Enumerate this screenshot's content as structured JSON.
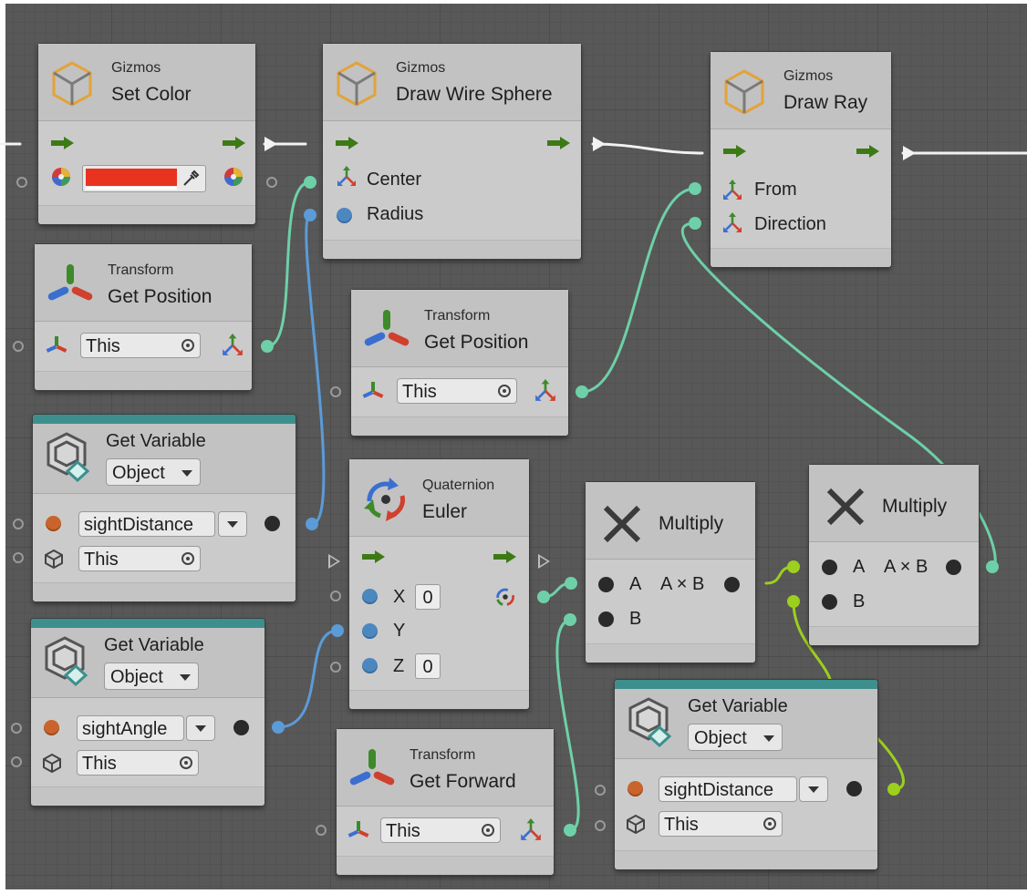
{
  "nodes": {
    "set_color": {
      "category": "Gizmos",
      "title": "Set Color",
      "color_value": "#e8331e"
    },
    "draw_wire_sphere": {
      "category": "Gizmos",
      "title": "Draw Wire Sphere",
      "center_label": "Center",
      "radius_label": "Radius"
    },
    "draw_ray": {
      "category": "Gizmos",
      "title": "Draw Ray",
      "from_label": "From",
      "direction_label": "Direction"
    },
    "get_position_1": {
      "category": "Transform",
      "title": "Get Position",
      "target": "This"
    },
    "get_position_2": {
      "category": "Transform",
      "title": "Get Position",
      "target": "This"
    },
    "get_var_1": {
      "title": "Get Variable",
      "kind": "Object",
      "name": "sightDistance",
      "target": "This"
    },
    "get_var_2": {
      "title": "Get Variable",
      "kind": "Object",
      "name": "sightAngle",
      "target": "This"
    },
    "get_var_3": {
      "title": "Get Variable",
      "kind": "Object",
      "name": "sightDistance",
      "target": "This"
    },
    "euler": {
      "category": "Quaternion",
      "title": "Euler",
      "x_label": "X",
      "x_value": "0",
      "y_label": "Y",
      "z_label": "Z",
      "z_value": "0"
    },
    "multiply_1": {
      "title": "Multiply",
      "a_label": "A",
      "b_label": "B",
      "out_label": "A × B"
    },
    "multiply_2": {
      "title": "Multiply",
      "a_label": "A",
      "b_label": "B",
      "out_label": "A × B"
    },
    "get_forward": {
      "category": "Transform",
      "title": "Get Forward",
      "target": "This"
    }
  },
  "colors": {
    "canvas": "#585858",
    "node_body": "#d2d2d2",
    "control_arrow": "#3d7a16",
    "vector_wire": "#6ed0a8",
    "float_wire": "#5b9bd8",
    "object_wire": "#9ccf1e",
    "variable_header": "#3d8f8d"
  },
  "icons": [
    "gizmo-cube-icon",
    "transform-axes-icon",
    "variable-icon",
    "quaternion-icon",
    "multiply-icon",
    "color-wheel-icon",
    "eyedropper-icon",
    "vector-icon",
    "target-icon"
  ]
}
